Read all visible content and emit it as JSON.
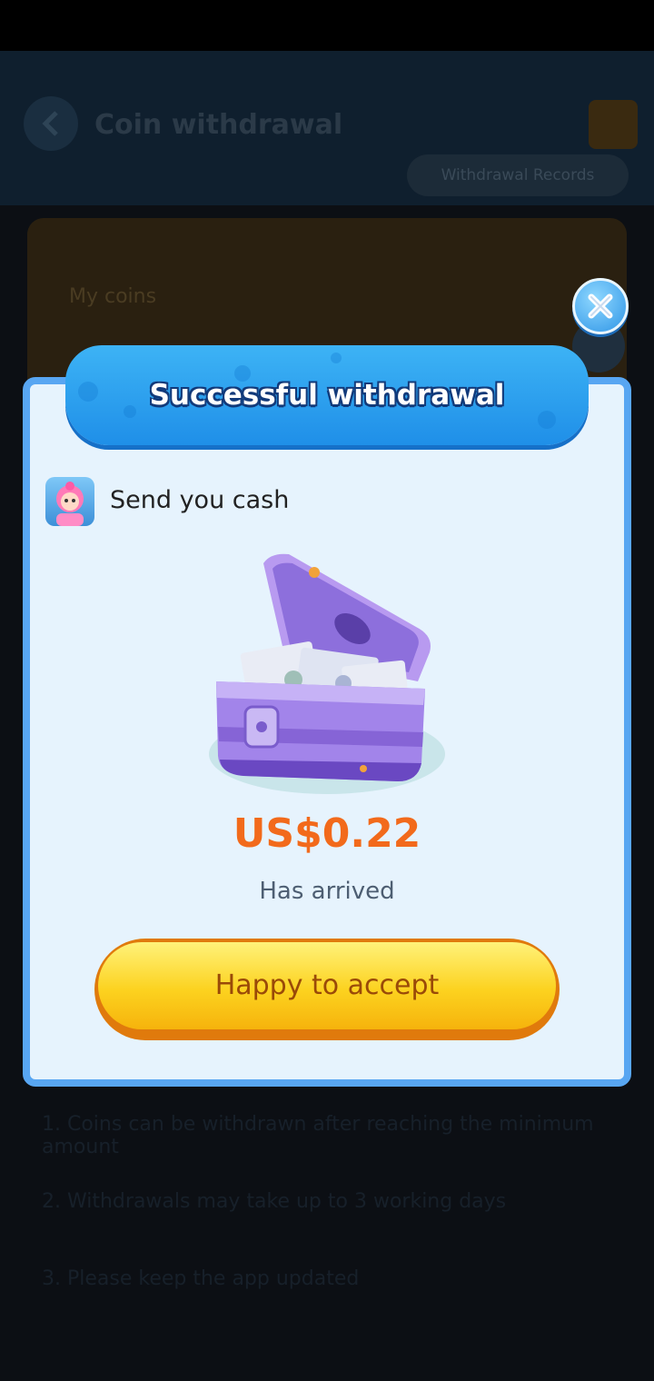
{
  "background": {
    "page_title": "Coin withdrawal",
    "records_button": "Withdrawal Records",
    "card_label": "My coins",
    "text_lines": [
      "1. Coins can be withdrawn after reaching the minimum amount",
      "2. Withdrawals may take up to 3 working days",
      "3. Please keep the app updated"
    ]
  },
  "dialog": {
    "title": "Successful withdrawal",
    "sender_text": "Send you cash",
    "amount": "US$0.22",
    "status": "Has arrived",
    "accept_button": "Happy to accept"
  },
  "colors": {
    "banner": "#2aa2f0",
    "dialog_border": "#58a6f2",
    "dialog_bg": "#e6f3fd",
    "amount": "#f26a1b",
    "button": "#fcd21f"
  },
  "icons": [
    "close-icon",
    "back-arrow-icon",
    "app-icon",
    "money-chest-icon"
  ]
}
